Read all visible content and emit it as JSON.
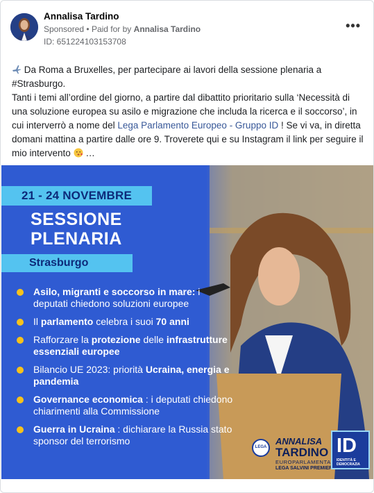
{
  "post": {
    "author": "Annalisa Tardino",
    "sponsored": "Sponsored",
    "separator": "•",
    "paid_for_by_prefix": "Paid for by",
    "paid_for_by": "Annalisa Tardino",
    "id": "ID: 651224103153708",
    "more_label": "•••",
    "text": {
      "line1": "Da Roma a Bruxelles, per partecipare ai lavori della sessione plenaria a #Strasburgo.",
      "line2_before": "Tanti i temi all’ordine del giorno, a partire dal dibattito prioritario sulla ‘Necessità di una soluzione europea su asilo e migrazione che includa la ricerca e il soccorso’, in cui interverrò a nome del ",
      "link": "Lega Parlamento Europeo - Gruppo ID",
      "line2_after": " ! Se vi va, in diretta domani mattina a partire dalle ore 9. Troverete qui e su Instagram il link per seguire il mio intervento",
      "ellipsis": "…"
    }
  },
  "banner": {
    "dates": "21 - 24 NOVEMBRE",
    "title_line1": "SESSIONE",
    "title_line2": "PLENARIA",
    "city": "Strasburgo",
    "items": [
      {
        "bold": "Asilo, migranti e soccorso in mare:",
        "rest": " i deputati chiedono soluzioni europee"
      },
      {
        "pre": "Il ",
        "bold": "parlamento",
        "mid": " celebra i suoi ",
        "bold2": "70 anni"
      },
      {
        "pre": "Rafforzare la ",
        "bold": "protezione",
        "mid": " delle ",
        "bold2": "infrastrutture essenziali europee"
      },
      {
        "pre": "Bilancio UE 2023: priorità ",
        "bold": "Ucraina, energia e pandemia"
      },
      {
        "bold": "Governance economica",
        "rest": " : i deputati chiedono chiarimenti alla Commissione"
      },
      {
        "bold": "Guerra in Ucraina",
        "rest": " : dichiarare la Russia stato sponsor del terrorismo"
      }
    ],
    "signature": {
      "first": "ANNALISA",
      "last": "TARDINO",
      "role": "EUROPARLAMENTARE",
      "party": "LEGA SALVINI PREMIER"
    },
    "lega_logo": "LEGA",
    "id_logo": "ID",
    "id_logo_sub": "IDENTITÀ E DEMOCRAZIA"
  },
  "colors": {
    "banner_blue": "#2d5bd0",
    "accent_cyan": "#54c3f0",
    "bullet_yellow": "#f6c21c",
    "link_blue": "#385898"
  },
  "icons": [
    "airplane-icon",
    "kiss-emoji-icon",
    "more-options-icon"
  ]
}
